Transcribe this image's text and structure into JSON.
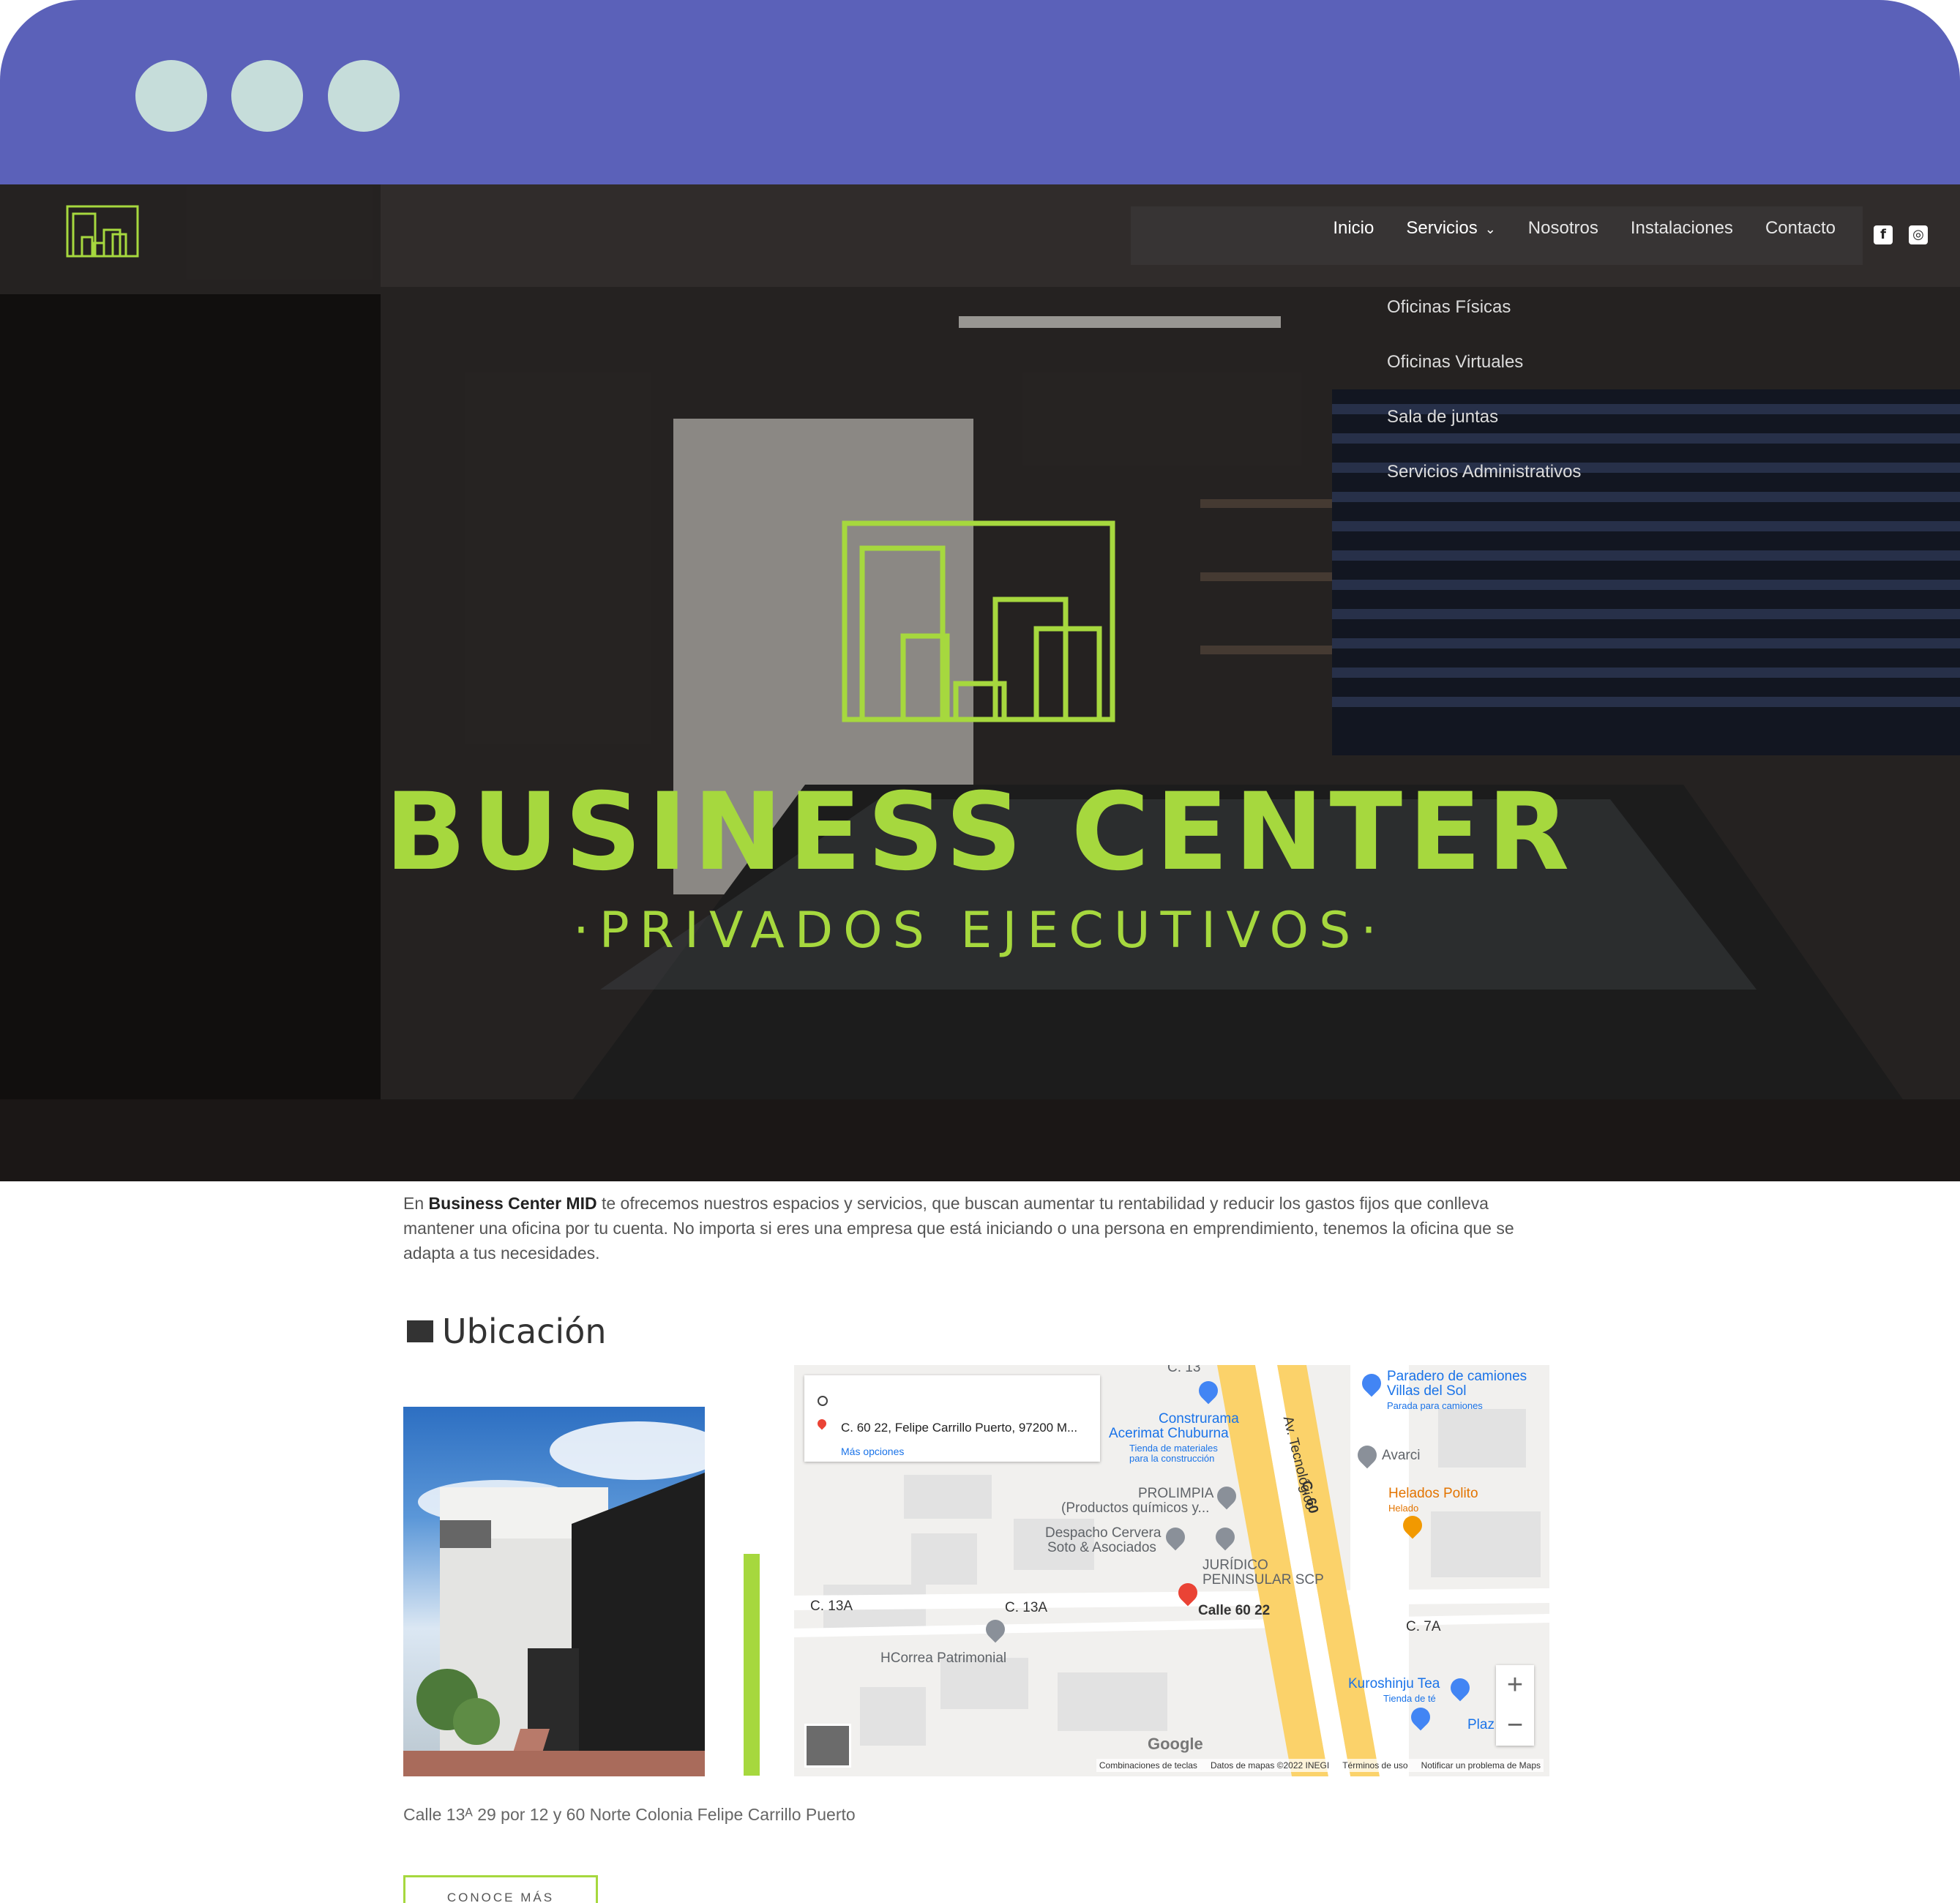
{
  "window": {
    "controls": [
      "circle",
      "circle",
      "circle"
    ]
  },
  "nav": {
    "items": [
      {
        "label": "Inicio"
      },
      {
        "label": "Servicios"
      },
      {
        "label": "Nosotros"
      },
      {
        "label": "Instalaciones"
      },
      {
        "label": "Contacto"
      }
    ],
    "dropdown": [
      "Oficinas Físicas",
      "Oficinas Virtuales",
      "Sala de juntas",
      "Servicios Administrativos"
    ],
    "social": [
      "facebook-icon",
      "instagram-icon"
    ]
  },
  "hero": {
    "title": "BUSINESS CENTER",
    "subtitle": "·PRIVADOS EJECUTIVOS·"
  },
  "intro": {
    "prefix": "En ",
    "brand": "Business Center MID",
    "rest": " te ofrecemos nuestros espacios y servicios, que buscan aumentar tu rentabilidad y reducir los gastos fijos que conlleva mantener una oficina por tu cuenta. No importa si eres una empresa que está iniciando o una persona en emprendimiento, tenemos la oficina que se adapta a tus necesidades."
  },
  "location": {
    "title": "Ubicación",
    "address": "Calle 13ᴬ 29 por 12 y 60 Norte Colonia Felipe Carrillo Puerto",
    "button": "CONOCE MÁS"
  },
  "map": {
    "card_address": "C. 60 22, Felipe Carrillo Puerto, 97200 M...",
    "more_options": "Más opciones",
    "labels": {
      "c13_top": "C. 13",
      "paradero": "Paradero de camiones",
      "paradero2": "Villas del Sol",
      "paradero_sub": "Parada para camiones",
      "construrama": "Construrama",
      "construrama2": "Acerimat Chuburna",
      "construrama_sub": "Tienda de materiales",
      "construrama_sub2": "para la construcción",
      "tecnologico": "Av. Tecnológico",
      "avarci": "Avarci",
      "helados": "Helados Polito",
      "helados_sub": "Helado",
      "c60": "C. 60",
      "prolimpia": "PROLIMPIA",
      "prolimpia2": "(Productos químicos y...",
      "despacho": "Despacho Cervera",
      "despacho2": "Soto & Asociados",
      "juridico": "JURÍDICO",
      "juridico2": "PENINSULAR SCP",
      "c13a_left": "C. 13A",
      "c13a_mid": "C. 13A",
      "calle6022": "Calle 60 22",
      "c7a": "C. 7A",
      "hcorrea": "HCorrea Patrimonial",
      "kuroshinju": "Kuroshinju Tea",
      "kuroshinju_sub": "Tienda de té",
      "plaza": "Plaz",
      "google": "Google"
    },
    "zoom_in": "+",
    "zoom_out": "−",
    "footer": [
      "Combinaciones de teclas",
      "Datos de mapas ©2022 INEGI",
      "Términos de uso",
      "Notificar un problema de Maps"
    ]
  },
  "colors": {
    "chrome": "#5b61b9",
    "accent": "#a6d83e",
    "dots": "#c6ddda"
  }
}
